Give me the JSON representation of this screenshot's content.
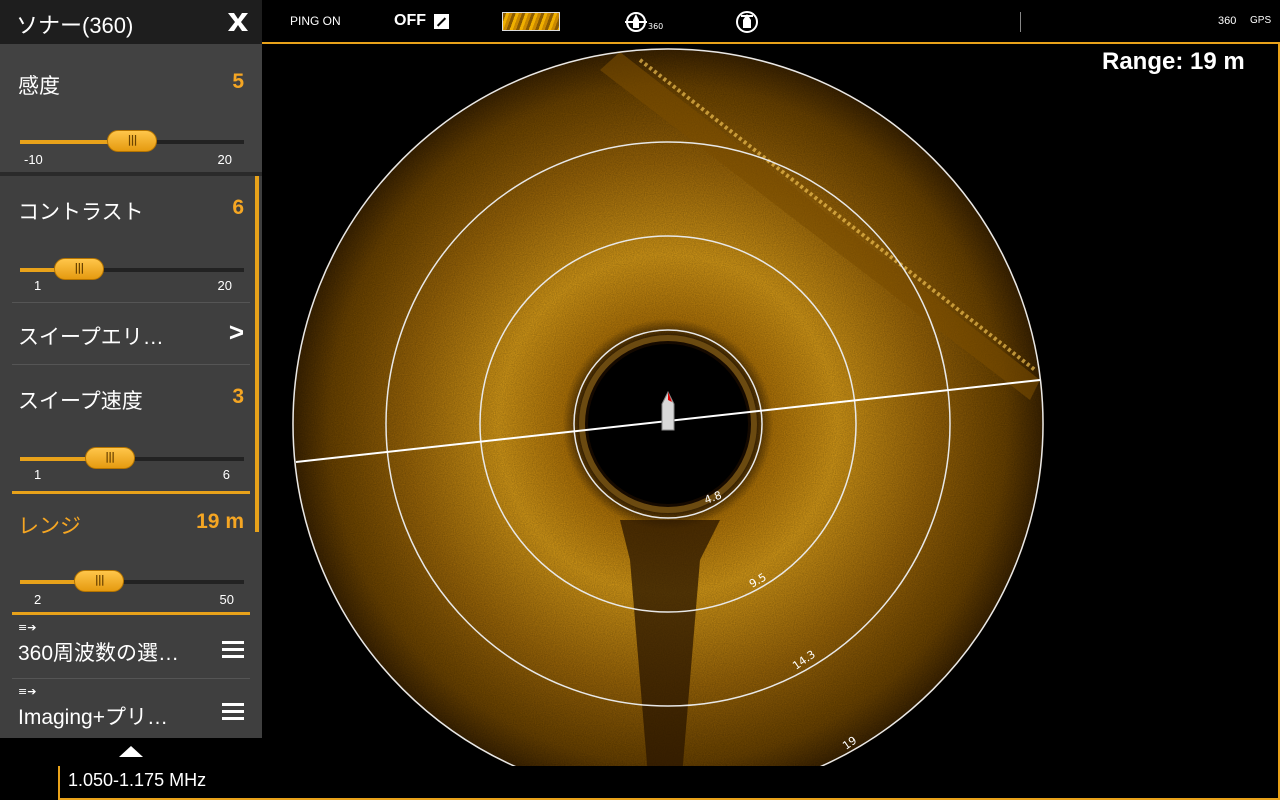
{
  "panel": {
    "title": "ソナー(360)",
    "sensitivity": {
      "label": "感度",
      "value": "5",
      "min": "-10",
      "max": "20",
      "level": 0.5
    },
    "contrast": {
      "label": "コントラスト",
      "value": "6",
      "min": "1",
      "max": "20",
      "level": 0.263
    },
    "sweep_area": {
      "label": "スイープエリ…",
      "chevron": ">"
    },
    "sweep_speed": {
      "label": "スイープ速度",
      "value": "3",
      "min": "1",
      "max": "6",
      "level": 0.4
    },
    "range": {
      "label": "レンジ",
      "value": "19 m",
      "min": "2",
      "max": "50",
      "level": 0.354
    },
    "freq_select": {
      "label": "360周波数の選…"
    },
    "imaging_preset": {
      "label": "Imaging+プリ…"
    }
  },
  "topbar": {
    "ping": "PING ON",
    "off": "OFF",
    "boat360_sub": "360",
    "s360": "360",
    "gps": "GPS"
  },
  "range_display": "Range: 19 m",
  "frequency": "1.050-1.175 MHz",
  "rings": [
    "4.8",
    "9.5",
    "14.3",
    "19"
  ],
  "colors": {
    "accent": "#e8a21a",
    "value": "#f5a623",
    "sonar": "#c98a10"
  }
}
